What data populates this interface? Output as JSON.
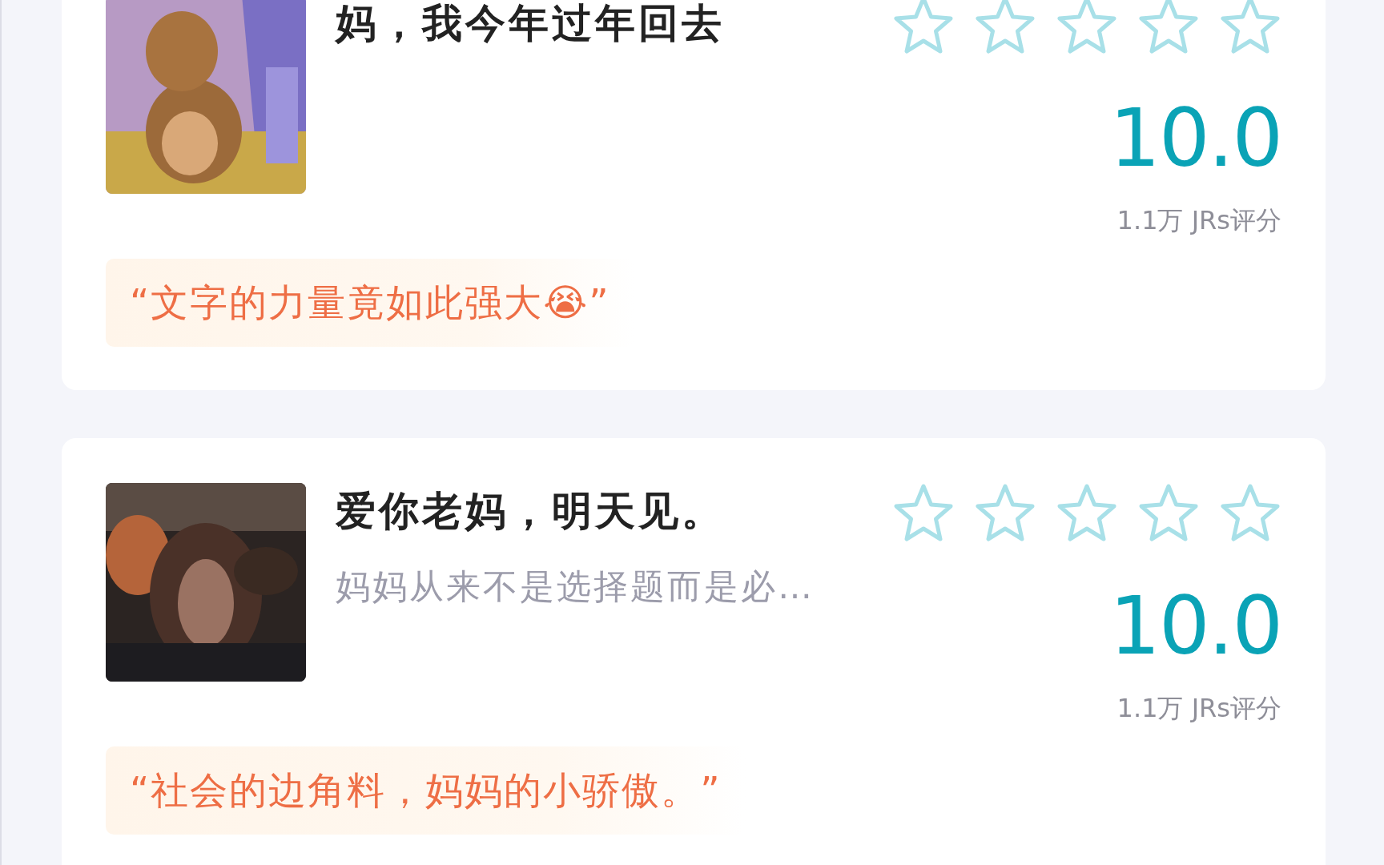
{
  "items": [
    {
      "title": "妈，我今年过年回去",
      "stars": 0,
      "score": "10.0",
      "rating_count": "1.1万 JRs评分",
      "quote": "“文字的力量竟如此强大😭”"
    },
    {
      "title": "爱你老妈，明天见。",
      "subtitle": "妈妈从来不是选择题而是必…",
      "stars": 0,
      "score": "10.0",
      "rating_count": "1.1万 JRs评分",
      "quote": "“社会的边角料，妈妈的小骄傲。”"
    }
  ]
}
